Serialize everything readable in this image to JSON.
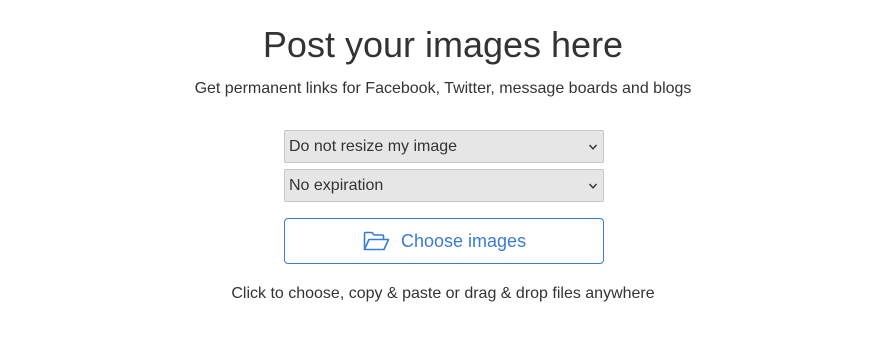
{
  "header": {
    "title": "Post your images here",
    "subtitle": "Get permanent links for Facebook, Twitter, message boards and blogs"
  },
  "options": {
    "resize": {
      "selected": "Do not resize my image"
    },
    "expiration": {
      "selected": "No expiration"
    }
  },
  "upload": {
    "button_label": "Choose images",
    "icon": "folder-open-icon",
    "hint": "Click to choose, copy & paste or drag & drop files anywhere"
  },
  "colors": {
    "accent": "#3a7bd5",
    "text": "#333333",
    "select_bg": "#e6e6e6"
  }
}
